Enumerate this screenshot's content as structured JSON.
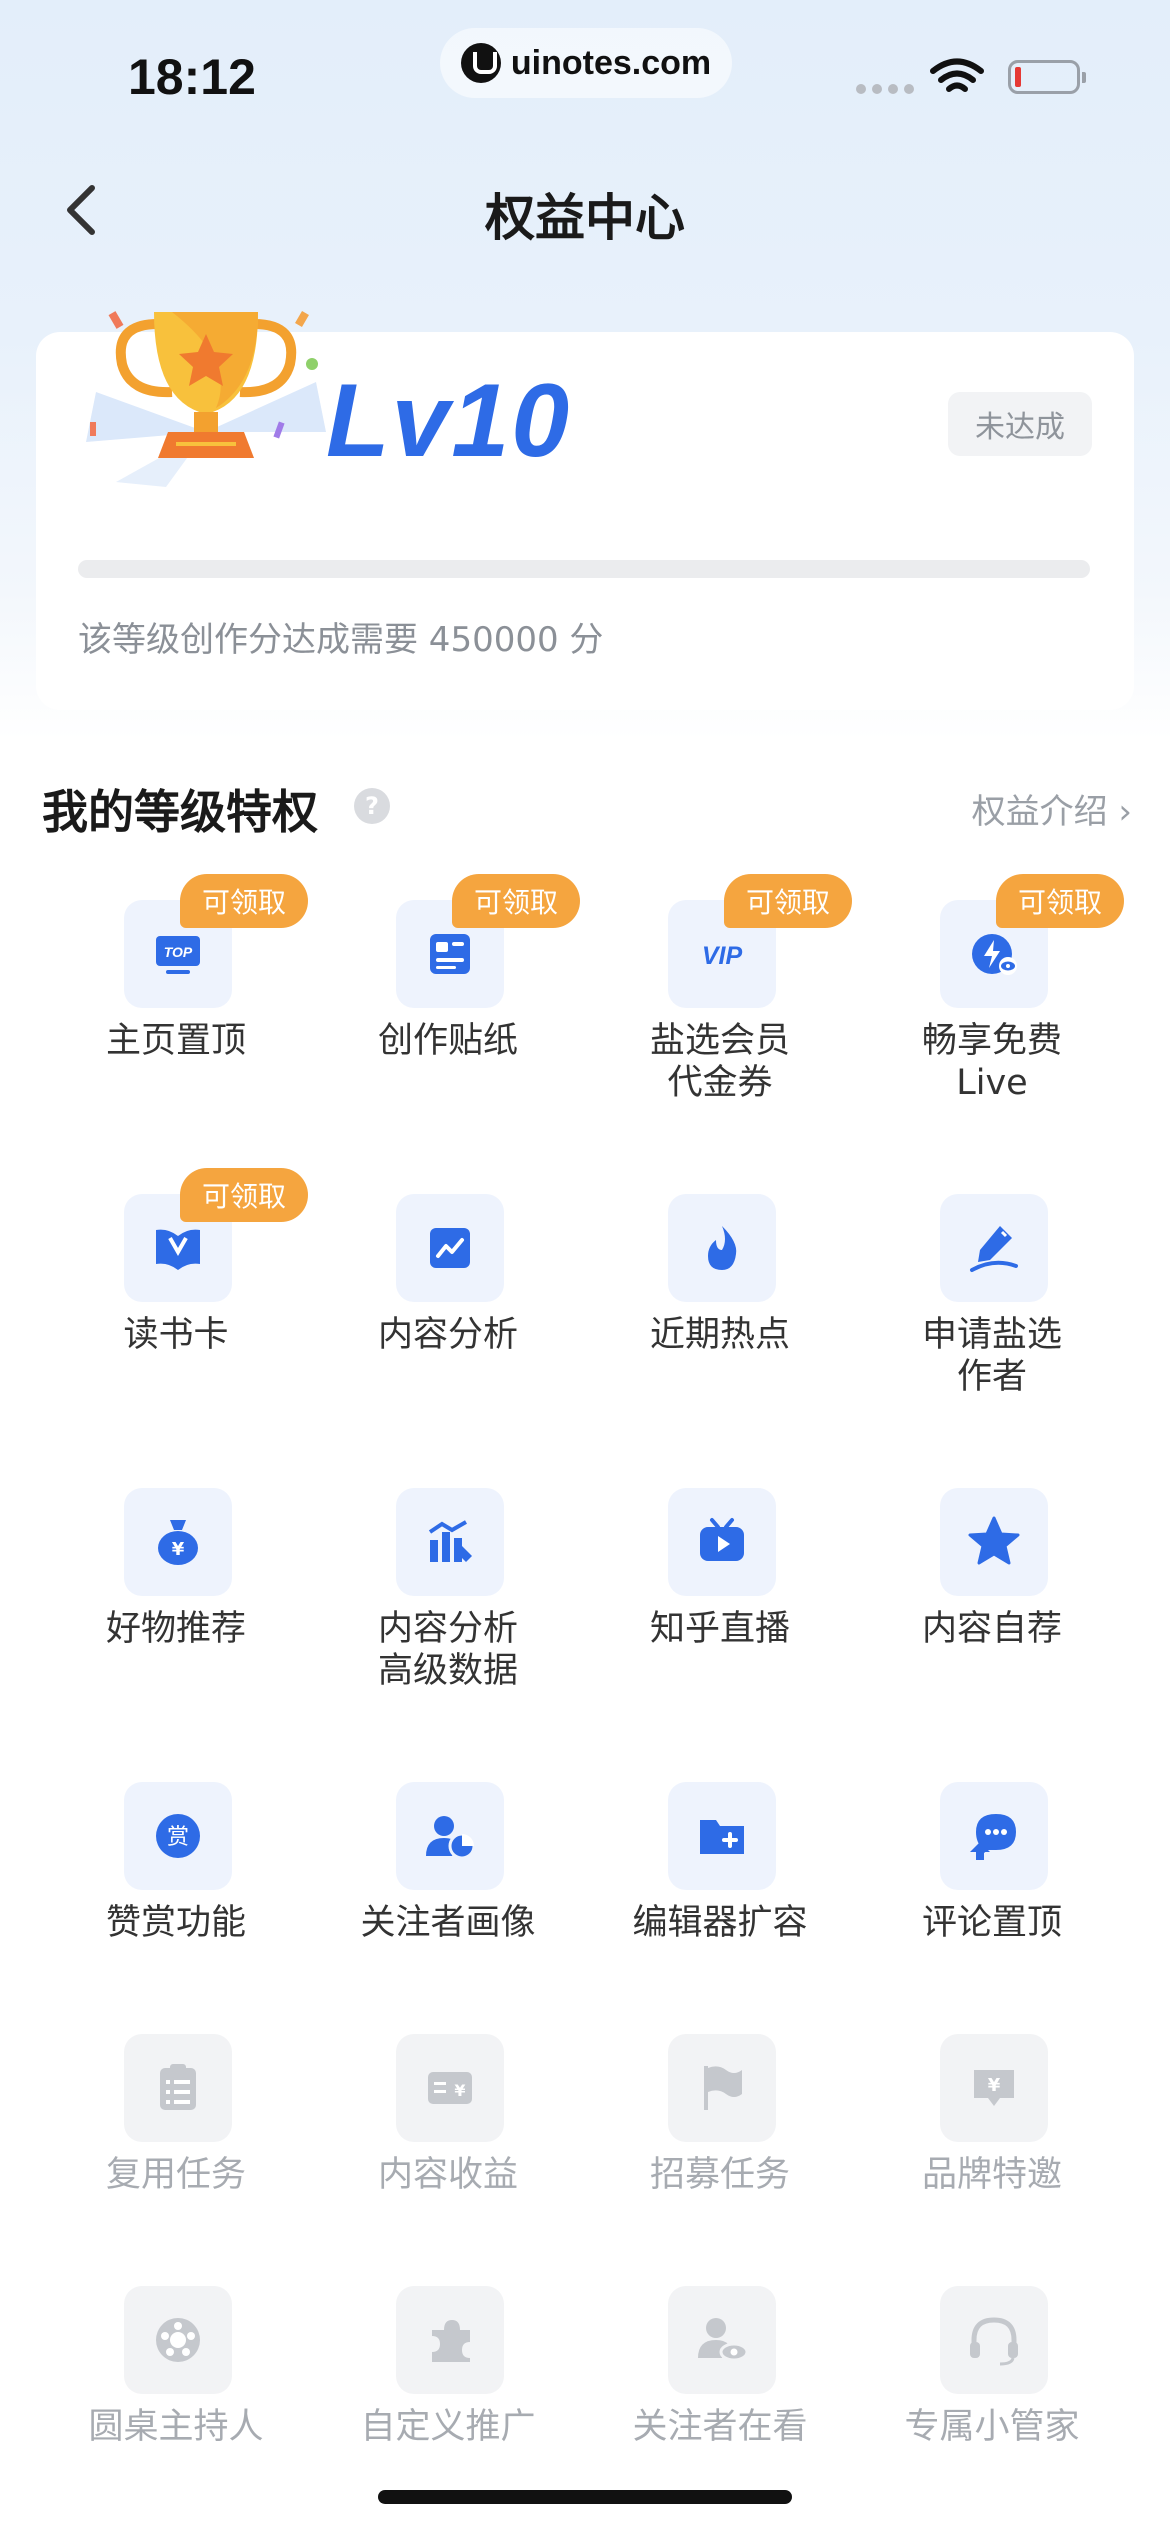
{
  "status_bar": {
    "time": "18:12",
    "url": "uinotes.com"
  },
  "nav": {
    "title": "权益中心"
  },
  "level_card": {
    "level": "Lv10",
    "status": "未达成",
    "progress": 0,
    "description": "该等级创作分达成需要 450000 分"
  },
  "section": {
    "title": "我的等级特权",
    "help": "?",
    "intro_link": "权益介绍 ›"
  },
  "colors": {
    "accent": "#2e6be6",
    "claim_badge": "#f5a53f",
    "disabled": "#a7abb1"
  },
  "privileges": [
    {
      "label": "主页置顶",
      "icon": "top-icon",
      "badge": "可领取",
      "enabled": true
    },
    {
      "label": "创作贴纸",
      "icon": "sticker-icon",
      "badge": "可领取",
      "enabled": true
    },
    {
      "label": "盐选会员\n代金券",
      "icon": "vip-icon",
      "badge": "可领取",
      "enabled": true
    },
    {
      "label": "畅享免费\nLive",
      "icon": "live-icon",
      "badge": "可领取",
      "enabled": true
    },
    {
      "label": "读书卡",
      "icon": "book-icon",
      "badge": "可领取",
      "enabled": true
    },
    {
      "label": "内容分析",
      "icon": "chart-icon",
      "badge": "",
      "enabled": true
    },
    {
      "label": "近期热点",
      "icon": "flame-icon",
      "badge": "",
      "enabled": true
    },
    {
      "label": "申请盐选\n作者",
      "icon": "pen-icon",
      "badge": "",
      "enabled": true
    },
    {
      "label": "好物推荐",
      "icon": "money-bag-icon",
      "badge": "",
      "enabled": true
    },
    {
      "label": "内容分析\n高级数据",
      "icon": "bar-chart-icon",
      "badge": "",
      "enabled": true
    },
    {
      "label": "知乎直播",
      "icon": "tv-play-icon",
      "badge": "",
      "enabled": true
    },
    {
      "label": "内容自荐",
      "icon": "star-icon",
      "badge": "",
      "enabled": true
    },
    {
      "label": "赞赏功能",
      "icon": "reward-icon",
      "badge": "",
      "enabled": true,
      "glyph": "赏"
    },
    {
      "label": "关注者画像",
      "icon": "user-pie-icon",
      "badge": "",
      "enabled": true
    },
    {
      "label": "编辑器扩容",
      "icon": "folder-plus-icon",
      "badge": "",
      "enabled": true
    },
    {
      "label": "评论置顶",
      "icon": "comment-top-icon",
      "badge": "",
      "enabled": true
    },
    {
      "label": "复用任务",
      "icon": "clipboard-icon",
      "badge": "",
      "enabled": false
    },
    {
      "label": "内容收益",
      "icon": "income-icon",
      "badge": "",
      "enabled": false,
      "glyph": "¥"
    },
    {
      "label": "招募任务",
      "icon": "flag-icon",
      "badge": "",
      "enabled": false
    },
    {
      "label": "品牌特邀",
      "icon": "brand-icon",
      "badge": "",
      "enabled": false,
      "glyph": "¥"
    },
    {
      "label": "圆桌主持人",
      "icon": "roundtable-icon",
      "badge": "",
      "enabled": false
    },
    {
      "label": "自定义推广",
      "icon": "puzzle-icon",
      "badge": "",
      "enabled": false
    },
    {
      "label": "关注者在看",
      "icon": "user-eye-icon",
      "badge": "",
      "enabled": false
    },
    {
      "label": "专属小管家",
      "icon": "headset-icon",
      "badge": "",
      "enabled": false
    }
  ]
}
